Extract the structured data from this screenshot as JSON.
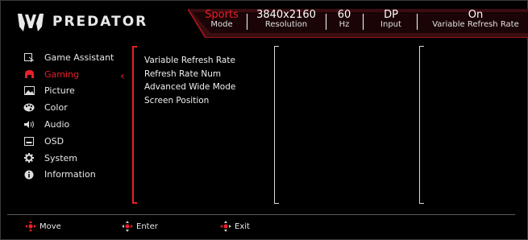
{
  "brand": {
    "name": "PREDATOR"
  },
  "header": {
    "items": [
      {
        "value": "Sports",
        "label": "Mode"
      },
      {
        "value": "3840x2160",
        "label": "Resolution"
      },
      {
        "value": "60",
        "label": "Hz"
      },
      {
        "value": "DP",
        "label": "Input"
      },
      {
        "value": "On",
        "label": "Variable Refresh Rate"
      }
    ]
  },
  "sidebar": {
    "items": [
      {
        "label": "Game Assistant",
        "icon": "game-assistant-icon"
      },
      {
        "label": "Gaming",
        "icon": "gaming-helmet-icon",
        "active": true
      },
      {
        "label": "Picture",
        "icon": "picture-icon"
      },
      {
        "label": "Color",
        "icon": "color-palette-icon"
      },
      {
        "label": "Audio",
        "icon": "speaker-icon"
      },
      {
        "label": "OSD",
        "icon": "osd-icon"
      },
      {
        "label": "System",
        "icon": "gear-icon"
      },
      {
        "label": "Information",
        "icon": "info-icon"
      }
    ]
  },
  "submenu": {
    "items": [
      "Variable Refresh Rate",
      "Refresh Rate Num",
      "Advanced Wide Mode",
      "Screen Position"
    ]
  },
  "footer": {
    "move": "Move",
    "enter": "Enter",
    "exit": "Exit"
  },
  "colors": {
    "accent": "#e8202a",
    "background": "#000000",
    "text": "#ffffff"
  }
}
